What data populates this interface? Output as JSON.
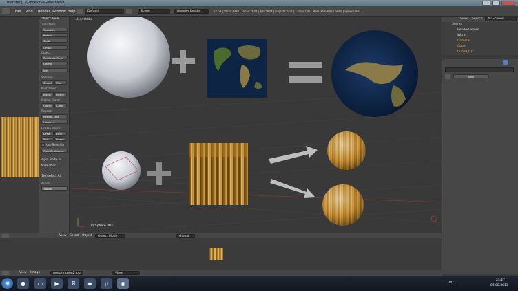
{
  "window": {
    "title": "Blender [C:\\Проекты\\Glass.blend]"
  },
  "menu": {
    "file": "File",
    "add": "Add",
    "render": "Render",
    "window": "Window",
    "help": "Help"
  },
  "header": {
    "layout": "Default",
    "scene": "Scene",
    "engine": "Blender Render",
    "stats": "v2.68 | Verts:2938 | Faces:2944 | Tris:5804 | Objects:0/11 | Lamps:0/0 | Mem:36.63M (4.56M) | Sphere.003"
  },
  "toolshelf": {
    "title": "Object Tools",
    "transform": "Transform:",
    "translate": "Translate",
    "rotate": "Rotate",
    "scale": "Scale",
    "origin": "Origin",
    "object": "Object:",
    "duplicate": "Duplicate Obje",
    "delete": "Delete",
    "join": "Join",
    "shading": "Shading:",
    "smooth": "Smoot",
    "flat": "Flat",
    "keyframes": "Keyframes:",
    "insert": "Insert",
    "remove": "Remo",
    "motion_paths": "Motion Paths:",
    "calculate": "Calcul",
    "clear": "Clear",
    "repeat": "Repeat:",
    "repeat_last": "Repeat Last",
    "history": "History...",
    "grease_pencil": "Grease Pencil:",
    "draw": "Draw",
    "line": "Line",
    "poly": "Poly",
    "erase": "Erase",
    "use_sketching": "Use Sketchin",
    "ruler": "Ruler/Protractor",
    "rigid_body": "Rigid Body To",
    "animation": "Animation",
    "deselect_all": "(De)select All",
    "action": "Action",
    "toggle": "Toggle"
  },
  "viewport": {
    "label": "User Ortho",
    "object": "(0) Sphere.003"
  },
  "outliner": {
    "view": "View",
    "search": "Search",
    "all_scenes": "All Scenes",
    "scene": "Scene",
    "render_layers": "RenderLayers",
    "world": "World",
    "camera": "Camera",
    "cube": "Cube",
    "cube001": "Cube.001"
  },
  "props": {
    "new": "New"
  },
  "viewport_header": {
    "view": "View",
    "select": "Select",
    "object": "Object",
    "mode": "Object Mode",
    "orientation": "Global"
  },
  "image_header": {
    "view": "View",
    "image": "Image",
    "filename": "texture.sphe2.jpg",
    "view_mode": "View"
  },
  "taskbar": {
    "lang": "RU",
    "time": "23:27",
    "date": "06.08.2013"
  },
  "colors": {
    "accent": "#5680c2",
    "hair": "#d9a441",
    "earth_ocean": "#0a1e3a"
  }
}
